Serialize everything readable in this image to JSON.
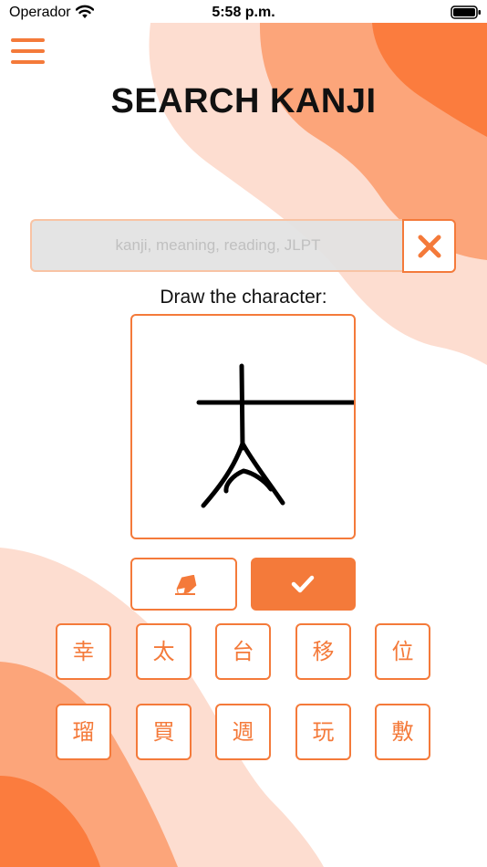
{
  "status_bar": {
    "carrier": "Operador",
    "time": "5:58 p.m."
  },
  "header": {
    "title": "SEARCH KANJI"
  },
  "search": {
    "placeholder": "kanji, meaning, reading, JLPT",
    "value": ""
  },
  "draw": {
    "label": "Draw the character:"
  },
  "candidates": [
    "幸",
    "太",
    "台",
    "移",
    "位",
    "瑠",
    "買",
    "週",
    "玩",
    "敷"
  ],
  "icons": {
    "menu": "hamburger-menu-icon",
    "clear": "close-icon",
    "erase": "eraser-icon",
    "confirm": "checkmark-icon"
  },
  "colors": {
    "accent": "#f47a3a",
    "accent_light": "#f8c3a4",
    "background_shape_light": "#fdddd0",
    "background_shape_mid": "#fca57a",
    "background_shape_dark": "#fb7c3e"
  }
}
